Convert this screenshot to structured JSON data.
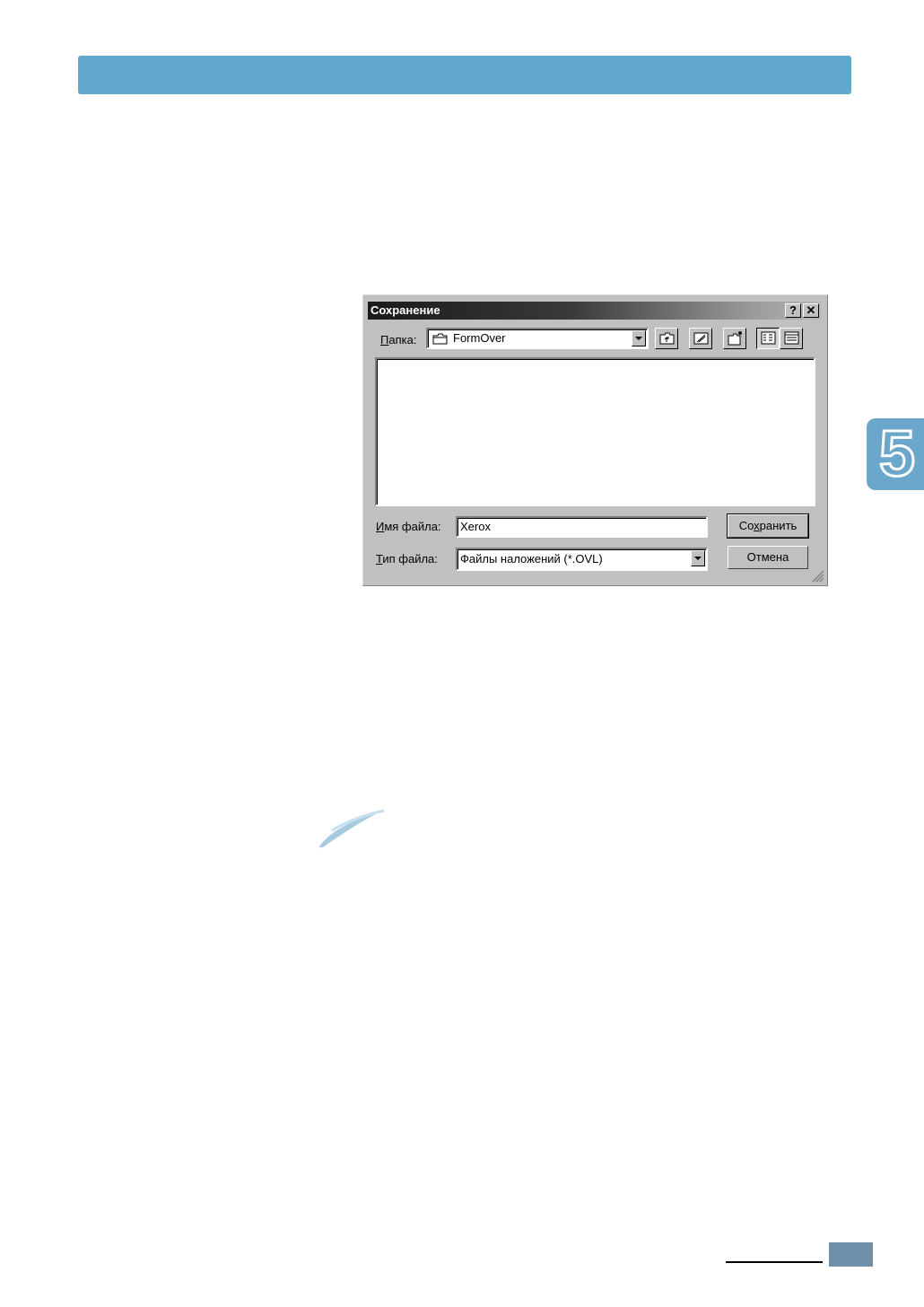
{
  "page": {
    "chapter_number": "5",
    "colors": {
      "accent": "#62a8cc",
      "footer_box": "#6f90a8"
    }
  },
  "dialog": {
    "title": "Сохранение",
    "help_glyph": "?",
    "close_glyph": "✕",
    "folder_label_underlined": "П",
    "folder_label_rest": "апка:",
    "folder_value": "FormOver",
    "toolbar": {
      "icons": [
        "up-folder-icon",
        "desktop-icon",
        "new-folder-icon",
        "list-view-icon",
        "details-view-icon"
      ]
    },
    "filename_label_underlined": "И",
    "filename_label_rest": "мя файла:",
    "filename_value": "Xerox",
    "filetype_label_underlined": "Т",
    "filetype_label_rest": "ип файла:",
    "filetype_value": "Файлы наложений (*.OVL)",
    "save_label_pre": "Со",
    "save_label_underlined": "х",
    "save_label_post": "ранить",
    "cancel_label": "Отмена"
  }
}
